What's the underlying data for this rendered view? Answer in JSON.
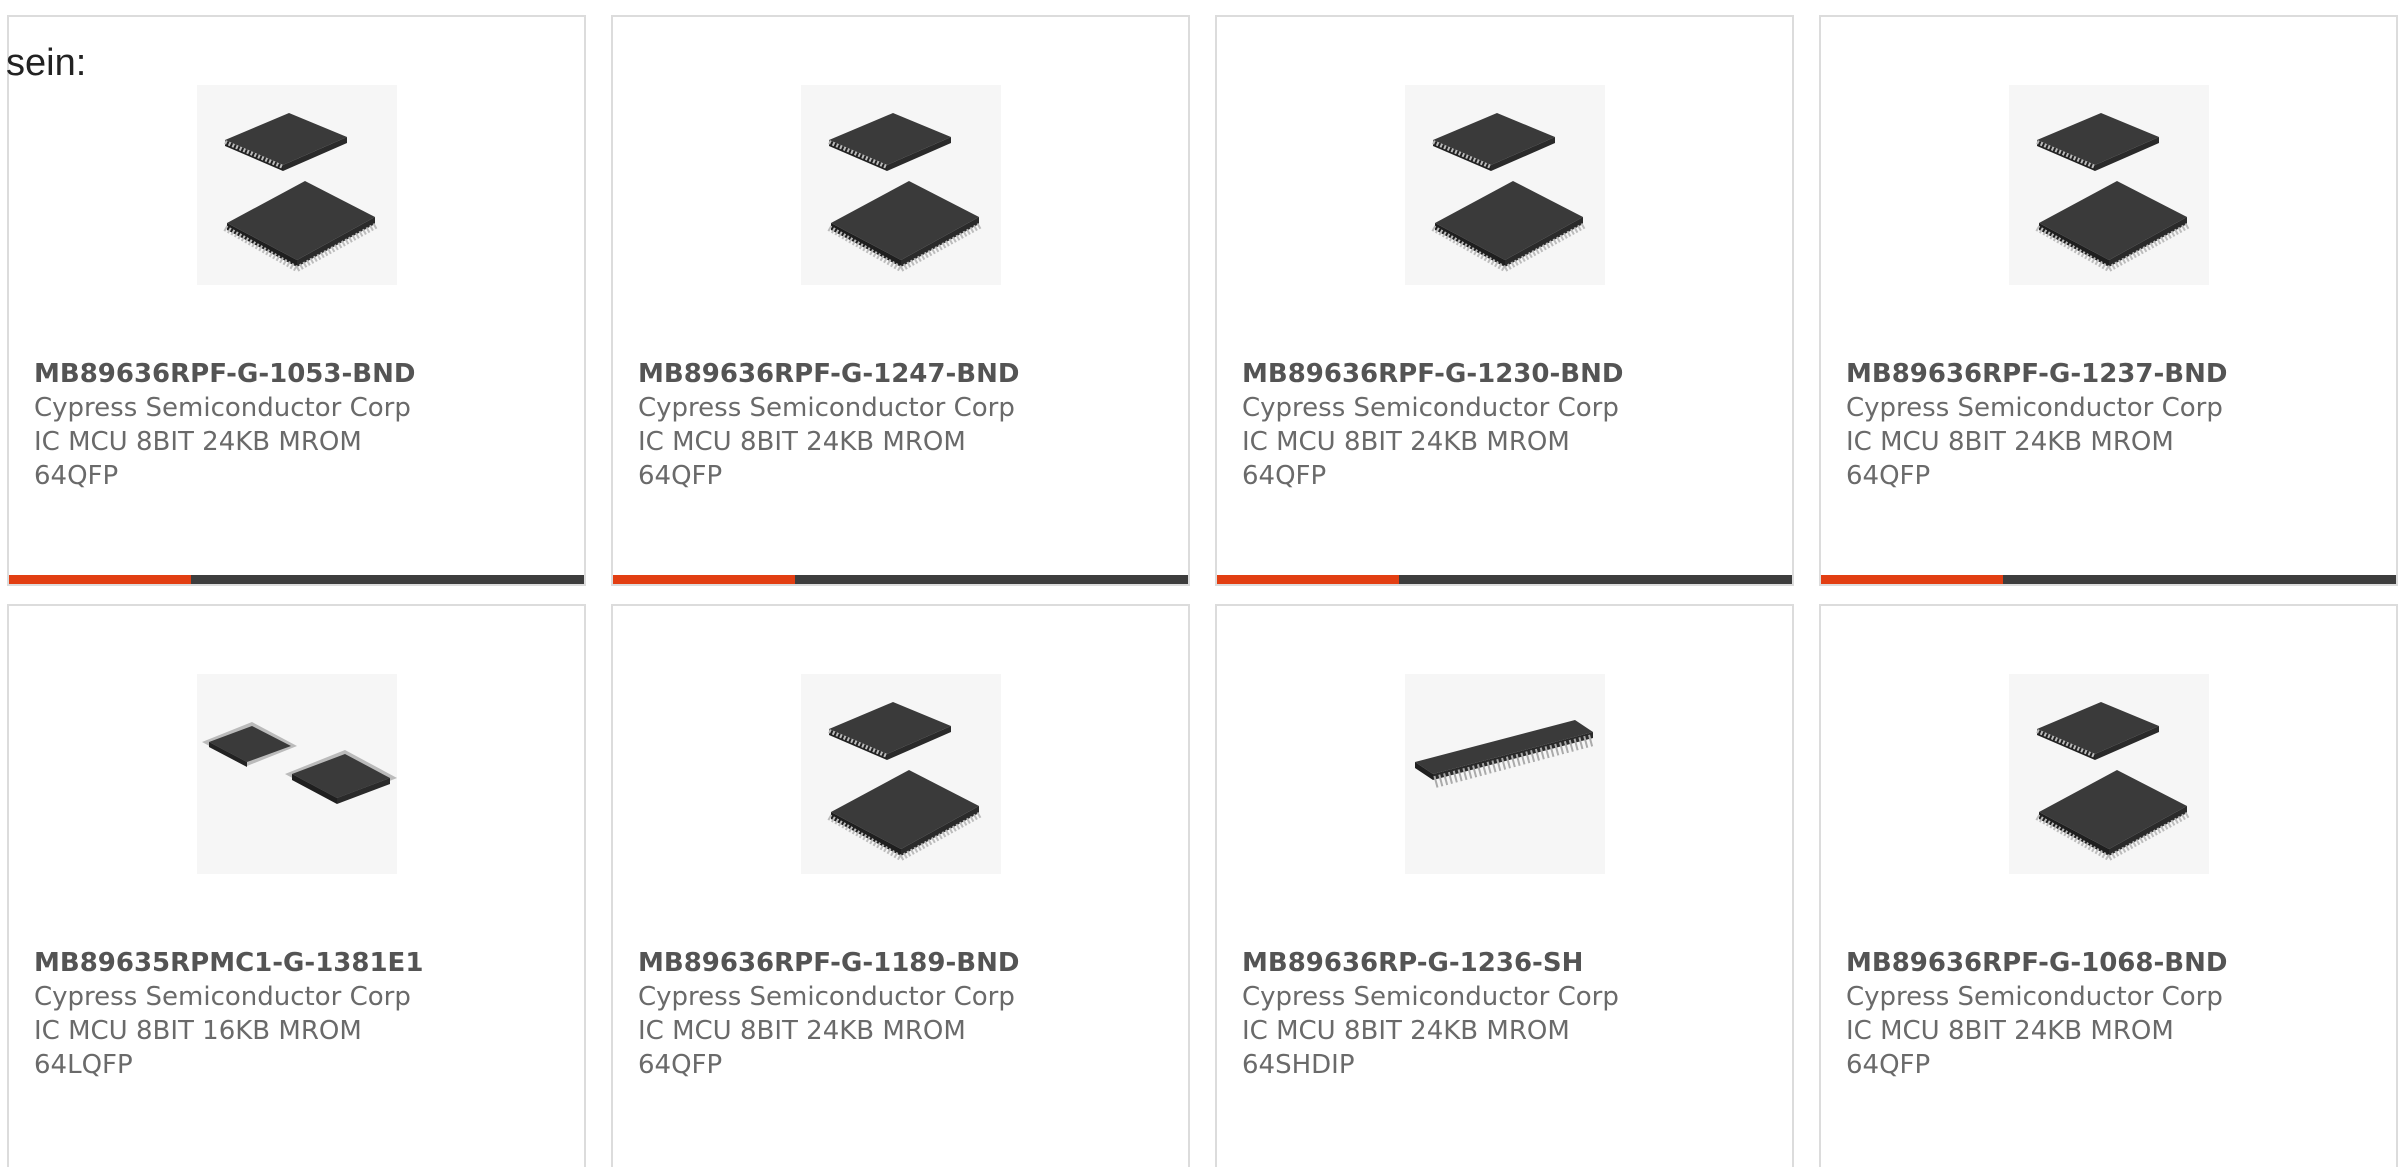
{
  "intro_text": "sein:",
  "products": [
    {
      "part": "MB89636RPF-G-1053-BND",
      "manufacturer": "Cypress Semiconductor Corp",
      "description": "IC MCU 8BIT 24KB MROM 64QFP",
      "image_icon": "qfp-chip-icon"
    },
    {
      "part": "MB89636RPF-G-1247-BND",
      "manufacturer": "Cypress Semiconductor Corp",
      "description": "IC MCU 8BIT 24KB MROM 64QFP",
      "image_icon": "qfp-chip-icon"
    },
    {
      "part": "MB89636RPF-G-1230-BND",
      "manufacturer": "Cypress Semiconductor Corp",
      "description": "IC MCU 8BIT 24KB MROM 64QFP",
      "image_icon": "qfp-chip-icon"
    },
    {
      "part": "MB89636RPF-G-1237-BND",
      "manufacturer": "Cypress Semiconductor Corp",
      "description": "IC MCU 8BIT 24KB MROM 64QFP",
      "image_icon": "qfp-chip-icon"
    },
    {
      "part": "MB89635RPMC1-G-1381E1",
      "manufacturer": "Cypress Semiconductor Corp",
      "description": "IC MCU 8BIT 16KB MROM 64LQFP",
      "image_icon": "lqfp-chip-icon"
    },
    {
      "part": "MB89636RPF-G-1189-BND",
      "manufacturer": "Cypress Semiconductor Corp",
      "description": "IC MCU 8BIT 24KB MROM 64QFP",
      "image_icon": "qfp-chip-icon"
    },
    {
      "part": "MB89636RP-G-1236-SH",
      "manufacturer": "Cypress Semiconductor Corp",
      "description": "IC MCU 8BIT 24KB MROM 64SHDIP",
      "image_icon": "shdip-chip-icon"
    },
    {
      "part": "MB89636RPF-G-1068-BND",
      "manufacturer": "Cypress Semiconductor Corp",
      "description": "IC MCU 8BIT 24KB MROM 64QFP",
      "image_icon": "qfp-chip-icon"
    }
  ],
  "colors": {
    "accent": "#e23e12",
    "bar": "#3d3d3d",
    "border": "#dcdcdc"
  }
}
